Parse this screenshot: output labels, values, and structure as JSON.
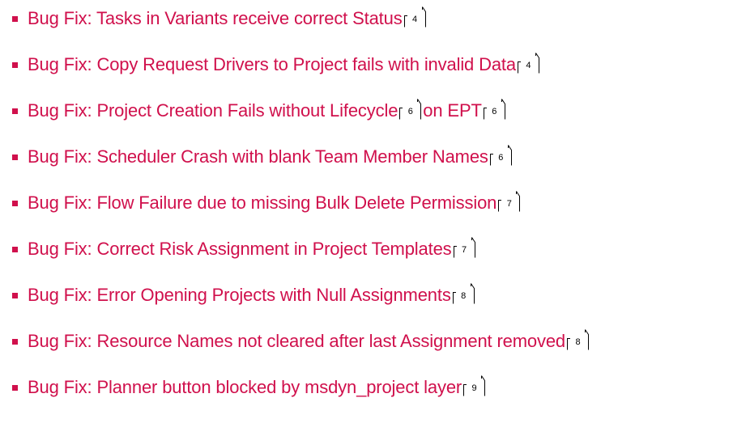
{
  "colors": {
    "link": "#D0104C",
    "bullet": "#D0104C",
    "page_ref_border": "#000000"
  },
  "icons": {
    "bullet": "square-bullet-icon",
    "page_ref": "page-reference-box-icon"
  },
  "toc": {
    "items": [
      {
        "label": "Bug Fix: Tasks in Variants receive correct Status",
        "page": "4"
      },
      {
        "label": "Bug Fix: Copy Request Drivers to Project fails with invalid Data",
        "page": "4"
      },
      {
        "label": "Bug Fix: Project Creation Fails without Lifecycle",
        "page": "6",
        "after": "on EPT",
        "after_page": "6"
      },
      {
        "label": "Bug Fix: Scheduler Crash with blank Team Member Names",
        "page": "6"
      },
      {
        "label": "Bug Fix: Flow Failure due to missing Bulk Delete Permission",
        "page": "7"
      },
      {
        "label": "Bug Fix: Correct Risk Assignment in Project Templates",
        "page": "7"
      },
      {
        "label": "Bug Fix: Error Opening Projects with Null Assignments",
        "page": "8"
      },
      {
        "label": "Bug Fix: Resource Names not cleared after last Assignment removed",
        "page": "8"
      },
      {
        "label": "Bug Fix: Planner button blocked by msdyn_project layer",
        "page": "9"
      }
    ]
  }
}
